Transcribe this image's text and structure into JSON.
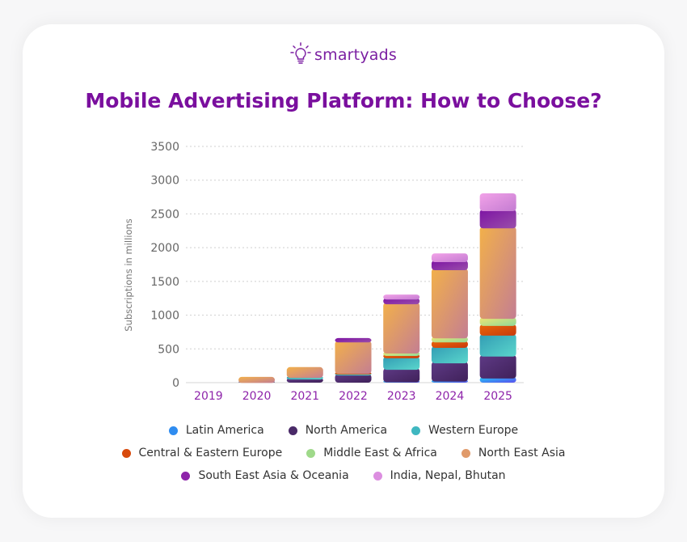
{
  "brand": {
    "name": "smartyads",
    "icon": "lightbulb-icon"
  },
  "title": "Mobile Advertising Platform: How to Choose?",
  "chart_data": {
    "type": "bar",
    "stacked": true,
    "title": "Mobile Advertising Platform: How to Choose?",
    "xlabel": "",
    "ylabel": "Subscriptions in millions",
    "ylim": [
      0,
      3500
    ],
    "yticks": [
      0,
      500,
      1000,
      1500,
      2000,
      2500,
      3000,
      3500
    ],
    "grid": true,
    "legend_position": "bottom",
    "categories": [
      "2019",
      "2020",
      "2021",
      "2022",
      "2023",
      "2024",
      "2025"
    ],
    "series": [
      {
        "name": "Latin America",
        "color": "#2f8cf0",
        "values": [
          0,
          0,
          0,
          0,
          30,
          40,
          85
        ]
      },
      {
        "name": "North America",
        "color": "#4a2a68",
        "values": [
          0,
          20,
          70,
          130,
          185,
          270,
          325
        ]
      },
      {
        "name": "Western Europe",
        "color": "#3fb7c0",
        "values": [
          0,
          0,
          25,
          15,
          170,
          230,
          310
        ]
      },
      {
        "name": "Central & Eastern Europe",
        "color": "#d84a0c",
        "values": [
          0,
          0,
          0,
          10,
          35,
          80,
          145
        ]
      },
      {
        "name": "Middle East & Africa",
        "color": "#9fd98a",
        "values": [
          0,
          0,
          0,
          0,
          35,
          60,
          105
        ]
      },
      {
        "name": "North East Asia",
        "color": "#e09a6a",
        "values": [
          0,
          65,
          135,
          465,
          730,
          1010,
          1340
        ]
      },
      {
        "name": "South East Asia & Oceania",
        "color": "#8e24aa",
        "values": [
          0,
          0,
          0,
          40,
          70,
          120,
          255
        ]
      },
      {
        "name": "India, Nepal, Bhutan",
        "color": "#dc8ee0",
        "values": [
          0,
          0,
          0,
          0,
          50,
          105,
          240
        ]
      }
    ]
  },
  "legend_rows": [
    [
      "Latin America",
      "North America",
      "Western Europe"
    ],
    [
      "Central & Eastern Europe",
      "Middle East & Africa",
      "North East Asia"
    ],
    [
      "South East Asia & Oceania",
      "India, Nepal, Bhutan"
    ]
  ]
}
